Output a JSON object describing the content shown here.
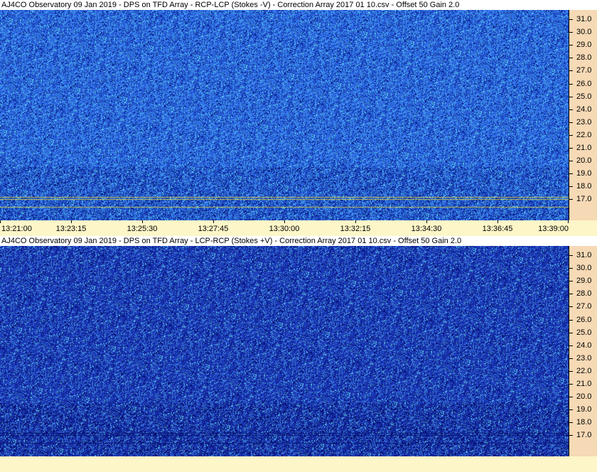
{
  "panels": [
    {
      "title": "AJ4CO Observatory 09 Jan 2019  -  DPS on TFD Array  -  RCP-LCP (Stokes -V)  -  Correction Array 2017 01 10.csv  -  Offset 50  Gain 2.0",
      "x_ticks": [
        "13:21:00",
        "13:23:15",
        "13:25:30",
        "13:27:45",
        "13:30:00",
        "13:32:15",
        "13:34:30",
        "13:36:45",
        "13:39:00"
      ],
      "y_ticks": [
        "31.0",
        "30.0",
        "29.0",
        "28.0",
        "27.0",
        "26.0",
        "25.0",
        "24.0",
        "23.0",
        "22.0",
        "21.0",
        "20.0",
        "19.0",
        "18.0",
        "17.0"
      ],
      "colors": {
        "base": "#2f6fe8",
        "dark": "#0a1f8c",
        "light": "#5fd0f0",
        "trace": "#e8e040"
      }
    },
    {
      "title": "AJ4CO Observatory 09 Jan 2019  -  DPS on TFD Array  -  LCP-RCP (Stokes +V)  -  Correction Array 2017 01 10.csv  -  Offset 50  Gain 2.0",
      "x_ticks": [],
      "y_ticks": [
        "31.0",
        "30.0",
        "29.0",
        "28.0",
        "27.0",
        "26.0",
        "25.0",
        "24.0",
        "23.0",
        "22.0",
        "21.0",
        "20.0",
        "19.0",
        "18.0",
        "17.0"
      ],
      "colors": {
        "base": "#1e3fc0",
        "dark": "#061070",
        "light": "#5fc8f0",
        "trace": "#061070"
      }
    }
  ],
  "axis_colors": {
    "y_axis_bg": "#f6d9b5",
    "x_axis_bg": "#fdf6c8"
  }
}
